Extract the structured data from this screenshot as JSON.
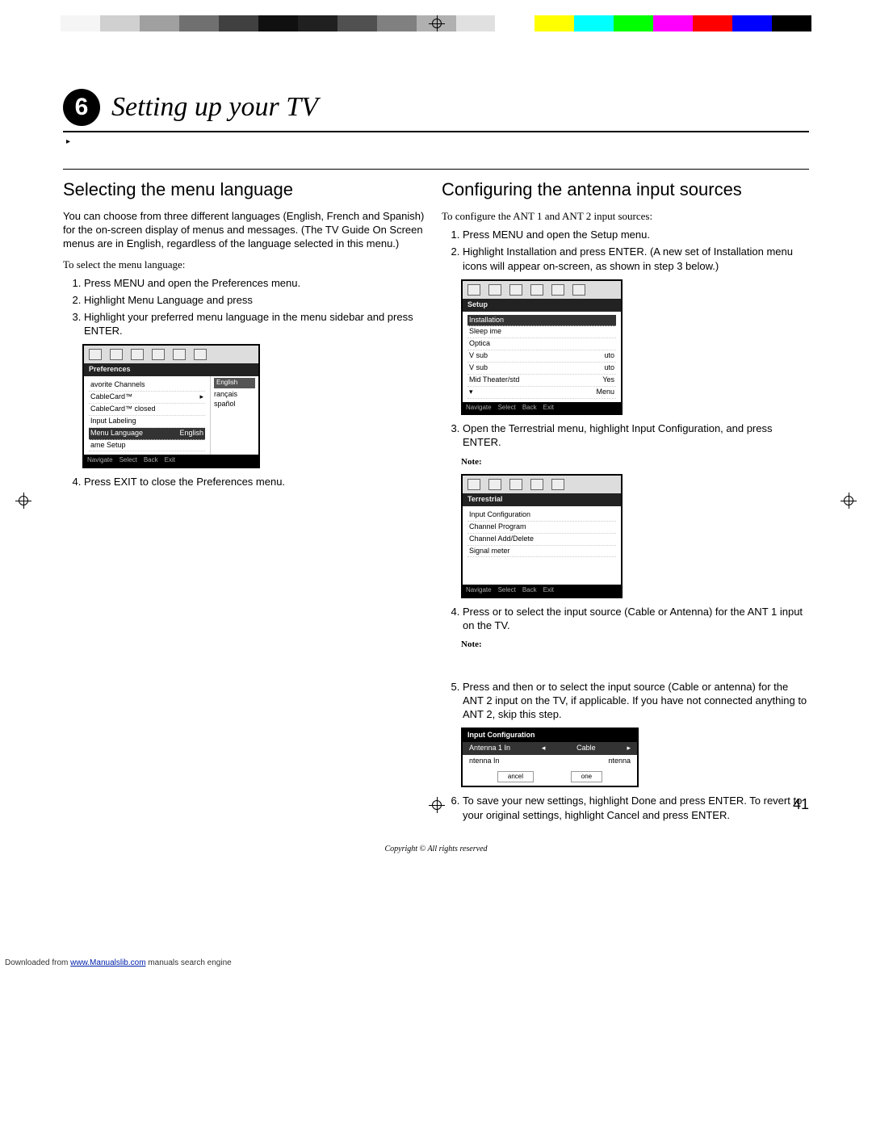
{
  "colorbar": [
    "#f5f5f5",
    "#d0d0d0",
    "#a0a0a0",
    "#707070",
    "#404040",
    "#101010",
    "#202020",
    "#505050",
    "#808080",
    "#b0b0b0",
    "#e0e0e0",
    "#ffffff",
    "#ffff00",
    "#00ffff",
    "#00ff00",
    "#ff00ff",
    "#ff0000",
    "#0000ff",
    "#000000"
  ],
  "chapter": {
    "num": "6",
    "title": "Setting up your TV"
  },
  "left": {
    "heading": "Selecting the menu language",
    "intro": "You can choose from three different languages (English, French and Spanish) for the on-screen display of menus and messages. (The TV Guide On Screen menus are in English, regardless of the language selected in this menu.)",
    "sub": "To select the menu language:",
    "steps": [
      "Press MENU and open the Preferences menu.",
      "Highlight Menu Language and press",
      "Highlight your preferred menu language in the menu sidebar and press ENTER."
    ],
    "step4": "Press EXIT to close the Preferences menu.",
    "menu": {
      "title": "Preferences",
      "rows": [
        "avorite Channels",
        "CableCard™",
        "CableCard™ closed",
        "Input Labeling"
      ],
      "hl": {
        "label": "Menu Language",
        "val": "English"
      },
      "after": [
        "ame Setup"
      ],
      "opts": [
        "English",
        "rançais",
        "spañol"
      ],
      "nav": [
        "Navigate",
        "Select",
        "Back",
        "Exit"
      ]
    }
  },
  "right": {
    "heading": "Configuring the antenna input sources",
    "sub": "To configure the ANT 1 and ANT 2 input sources:",
    "step1": "Press MENU and open the Setup menu.",
    "step2": "Highlight Installation and press ENTER. (A new set of Installation menu icons will appear on-screen, as shown in step 3 below.)",
    "step3": "Open the Terrestrial menu, highlight Input Configuration, and press ENTER.",
    "step4": "Press   or   to select the input source (Cable or Antenna) for the ANT 1 input on the TV.",
    "step5": "Press   and then   or   to select the input source (Cable or antenna) for the ANT 2 input on the TV, if applicable. If you have not connected anything to ANT 2, skip this step.",
    "step6": "To save your new settings, highlight Done and press ENTER. To revert to your original settings, highlight Cancel and press ENTER.",
    "note": "Note:",
    "setupMenu": {
      "title": "Setup",
      "hl": "Installation",
      "rows": [
        {
          "l": "Sleep ime",
          "r": ""
        },
        {
          "l": "Optica",
          "r": ""
        },
        {
          "l": "V sub",
          "r": "uto"
        },
        {
          "l": "V sub",
          "r": "uto"
        },
        {
          "l": "Mid Theater/std",
          "r": "Yes"
        },
        {
          "l": "Menu",
          "r": ""
        }
      ],
      "nav": [
        "Navigate",
        "Select",
        "Back",
        "Exit"
      ]
    },
    "terrMenu": {
      "title": "Terrestrial",
      "rows": [
        "Input Configuration",
        "Channel Program",
        "Channel Add/Delete",
        "Signal meter"
      ],
      "nav": [
        "Navigate",
        "Select",
        "Back",
        "Exit"
      ]
    },
    "inputConf": {
      "title": "Input Configuration",
      "rows": [
        {
          "l": "Antenna 1 In",
          "r": "Cable",
          "hl": true
        },
        {
          "l": "ntenna  In",
          "r": "ntenna",
          "hl": false
        }
      ],
      "btns": [
        "ancel",
        "one"
      ]
    }
  },
  "copyright": "Copyright © All rights reserved",
  "pageNum": "41",
  "manualslib": {
    "pre": "Downloaded from ",
    "link": "www.Manualslib.com",
    "post": " manuals search engine"
  }
}
